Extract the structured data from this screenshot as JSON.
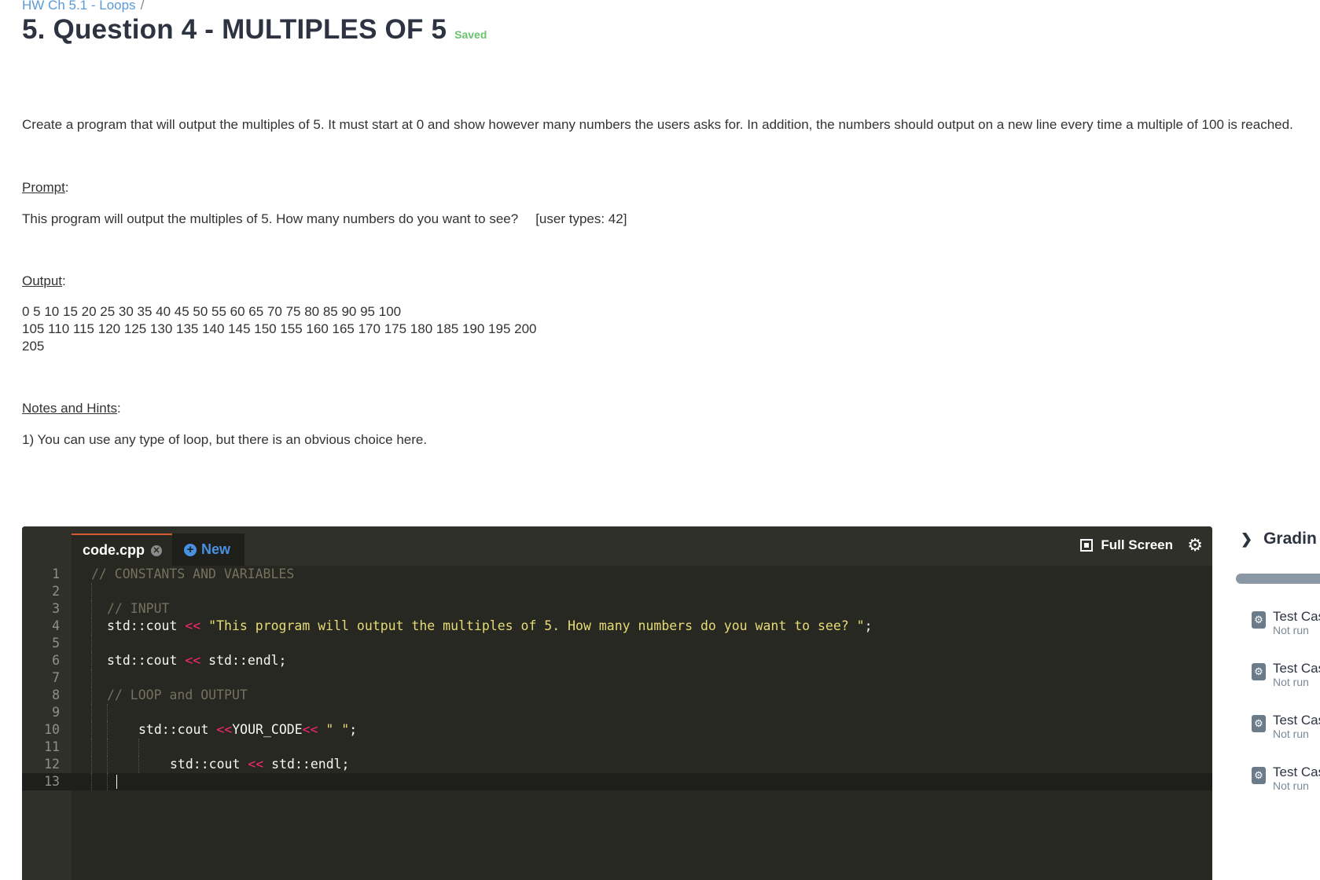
{
  "breadcrumb": {
    "parent": "HW Ch 5.1 - Loops",
    "separator": "/"
  },
  "title": "5. Question 4 - MULTIPLES OF 5",
  "saved_label": "Saved",
  "description": "Create a program that will output the multiples of 5. It must start at 0 and show however many numbers the users asks for. In addition, the numbers should output on a new line every time a multiple of 100 is reached.",
  "prompt": {
    "heading": "Prompt",
    "text": "This program will output the multiples of 5. How many numbers do you want to see?",
    "user_input": "[user types: 42]"
  },
  "output": {
    "heading": "Output",
    "lines": [
      "0 5 10 15 20 25 30 35 40 45 50 55 60 65 70 75 80 85 90 95 100",
      "105 110 115 120 125 130 135 140 145 150 155 160 165 170 175 180 185 190 195 200",
      "205"
    ]
  },
  "notes": {
    "heading": "Notes and Hints",
    "text": "1) You can use any type of loop, but there is an obvious choice here."
  },
  "editor": {
    "file_tab": "code.cpp",
    "new_tab": "New",
    "fullscreen_label": "Full Screen",
    "lines": [
      "1",
      "2",
      "3",
      "4",
      "5",
      "6",
      "7",
      "8",
      "9",
      "10",
      "11",
      "12",
      "13"
    ],
    "code": {
      "l1": "// CONSTANTS AND VARIABLES",
      "l3": "// INPUT",
      "l4_a": "std::cout ",
      "l4_op": "<<",
      "l4_str": " \"This program will output the multiples of 5. How many numbers do you want to see? \"",
      "l4_end": ";",
      "l6_a": "std::cout ",
      "l6_op": "<<",
      "l6_b": " std::endl;",
      "l8": "// LOOP and OUTPUT",
      "l10_a": "std::cout ",
      "l10_op1": "<<",
      "l10_b": "YOUR_CODE",
      "l10_op2": "<<",
      "l10_str": " \" \"",
      "l10_end": ";",
      "l12_a": "std::cout ",
      "l12_op": "<<",
      "l12_b": " std::endl;"
    }
  },
  "grading": {
    "heading": "Gradin",
    "test_cases": [
      {
        "name": "Test Cas",
        "status": "Not run"
      },
      {
        "name": "Test Cas",
        "status": "Not run"
      },
      {
        "name": "Test Cas",
        "status": "Not run"
      },
      {
        "name": "Test Cas",
        "status": "Not run"
      }
    ]
  }
}
